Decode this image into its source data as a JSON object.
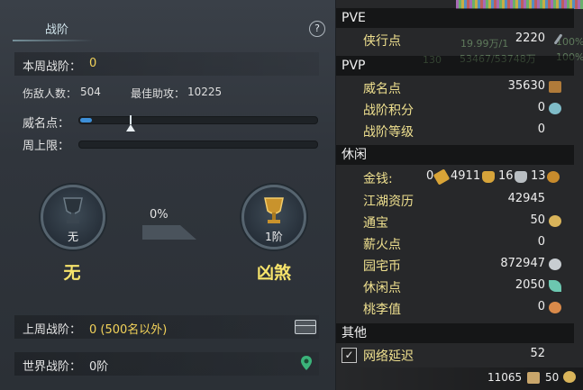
{
  "left": {
    "title": "战阶",
    "help_icon": "?",
    "weekly_rank_label": "本周战阶：",
    "weekly_rank_value": "0",
    "kills_label": "伤敌人数：",
    "kills_value": "504",
    "best_assist_label": "最佳助攻：",
    "best_assist_value": "10225",
    "prestige_label": "威名点：",
    "weekly_cap_label": "周上限：",
    "progress_percent_text": "0%",
    "current_badge_caption": "无",
    "current_rank_name": "无",
    "next_badge_caption": "1阶",
    "next_rank_name": "凶煞",
    "last_week_label": "上周战阶：",
    "last_week_value": "0 (500名以外)",
    "world_rank_label": "世界战阶：",
    "world_rank_value": "0阶",
    "prestige_fill": 0.05,
    "colors": {
      "accent_yellow": "#f3d35a",
      "bar_fill": "#3d8fd8"
    }
  },
  "right": {
    "faint_overlay": [
      "19.99万/1",
      "100%",
      "130",
      "53467/53748万",
      "100%"
    ],
    "sections": {
      "pve": "PVE",
      "pvp": "PVP",
      "leisure": "休闲",
      "other": "其他"
    },
    "pve_rows": [
      {
        "name": "侠行点",
        "value": "2220",
        "icon": "sword-icon"
      }
    ],
    "pvp_rows": [
      {
        "name": "威名点",
        "value": "35630",
        "icon": "prestige-icon"
      },
      {
        "name": "战阶积分",
        "value": "0",
        "icon": "crystal-icon"
      },
      {
        "name": "战阶等级",
        "value": "0",
        "icon": ""
      }
    ],
    "money": {
      "label": "金钱:",
      "gold_ticket": "0",
      "gold": "4911",
      "silver": "16",
      "copper": "13"
    },
    "leisure_rows": [
      {
        "name": "江湖资历",
        "value": "42945",
        "icon": ""
      },
      {
        "name": "通宝",
        "value": "50",
        "icon": "coin-icon"
      },
      {
        "name": "薪火点",
        "value": "0",
        "icon": ""
      },
      {
        "name": "园宅币",
        "value": "872947",
        "icon": "g-coin-icon"
      },
      {
        "name": "休闲点",
        "value": "2050",
        "icon": "leaf-icon"
      },
      {
        "name": "桃李值",
        "value": "0",
        "icon": "peach-icon"
      }
    ],
    "other_rows": [
      {
        "name": "网络延迟",
        "value": "52",
        "checked": true
      }
    ],
    "footer": {
      "left_value": "11065",
      "right_value": "50"
    }
  }
}
